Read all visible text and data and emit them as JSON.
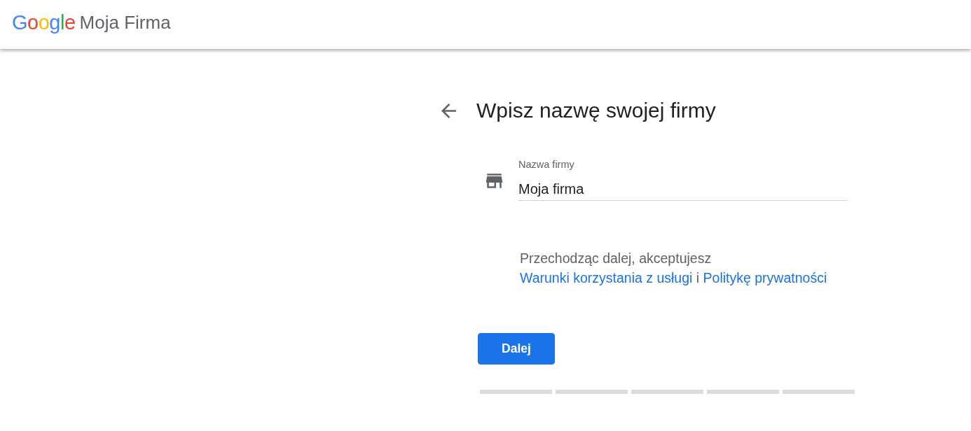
{
  "header": {
    "logo": "Google",
    "product": "Moja Firma"
  },
  "title": "Wpisz nazwę swojej firmy",
  "field": {
    "label": "Nazwa firmy",
    "value": "Moja firma"
  },
  "terms": [
    {
      "kind": "text",
      "text": "Przechodząc dalej, akceptujesz"
    },
    {
      "kind": "link",
      "text": "Warunki korzystania z usługi"
    },
    {
      "kind": "text",
      "text": "i"
    },
    {
      "kind": "link",
      "text": "Politykę prywatności"
    }
  ],
  "button": "Dalej",
  "steps": [
    {
      "completed": false
    },
    {
      "completed": false
    },
    {
      "completed": false
    },
    {
      "completed": false
    },
    {
      "completed": false
    }
  ]
}
